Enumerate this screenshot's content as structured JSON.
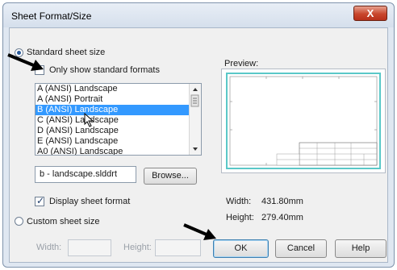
{
  "window": {
    "title": "Sheet Format/Size",
    "close_label": "X"
  },
  "standard": {
    "label": "Standard sheet size"
  },
  "only_standard": {
    "label": "Only show standard formats"
  },
  "sizes": [
    "A (ANSI) Landscape",
    "A (ANSI) Portrait",
    "B (ANSI) Landscape",
    "C (ANSI) Landscape",
    "D (ANSI) Landscape",
    "E (ANSI) Landscape",
    "A0 (ANSI) Landscape"
  ],
  "selected_index": 2,
  "format_file": {
    "value": "b - landscape.slddrt"
  },
  "browse": {
    "label": "Browse..."
  },
  "display_format": {
    "label": "Display sheet format",
    "checked": true
  },
  "custom": {
    "label": "Custom sheet size"
  },
  "custom_width": {
    "label": "Width:"
  },
  "custom_height": {
    "label": "Height:"
  },
  "preview": {
    "label": "Preview:"
  },
  "dims": {
    "width_label": "Width:",
    "width_value": "431.80mm",
    "height_label": "Height:",
    "height_value": "279.40mm"
  },
  "buttons": {
    "ok": "OK",
    "cancel": "Cancel",
    "help": "Help"
  },
  "colors": {
    "selection": "#3399ff",
    "preview_border": "#5ac8c8",
    "annotation_arrow": "#000000"
  }
}
